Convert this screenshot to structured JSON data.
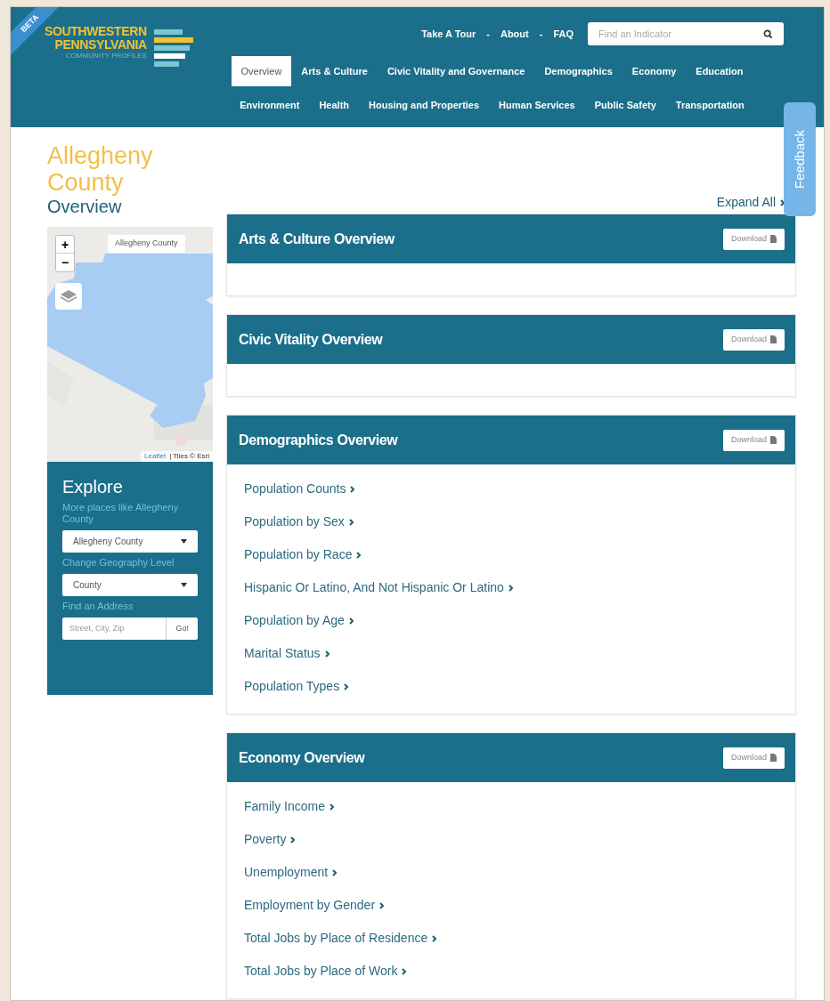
{
  "ribbon": "BETA",
  "logo": {
    "line_1": "SOUTHWESTERN",
    "line_2": "PENNSYLVANIA",
    "tagline": "COMMUNITY PROFILES"
  },
  "top_links": [
    {
      "label": "Take A Tour"
    },
    {
      "label": "About"
    },
    {
      "label": "FAQ"
    }
  ],
  "separator": "-",
  "search": {
    "placeholder": "Find an Indicator"
  },
  "nav_rows": [
    [
      {
        "label": "Overview",
        "selected": true
      },
      {
        "label": "Arts & Culture",
        "selected": false
      },
      {
        "label": "Civic Vitality and Governance",
        "selected": false
      },
      {
        "label": "Demographics",
        "selected": false
      },
      {
        "label": "Economy",
        "selected": false
      },
      {
        "label": "Education",
        "selected": false
      }
    ],
    [
      {
        "label": "Environment",
        "selected": false
      },
      {
        "label": "Health",
        "selected": false
      },
      {
        "label": "Housing and Properties",
        "selected": false
      },
      {
        "label": "Human Services",
        "selected": false
      },
      {
        "label": "Public Safety",
        "selected": false
      },
      {
        "label": "Transportation",
        "selected": false
      }
    ]
  ],
  "feedback": "Feedback",
  "place": {
    "name": "Allegheny County",
    "subtitle": "Overview"
  },
  "map": {
    "zoom_in": "+",
    "zoom_out": "−",
    "label": "Allegheny County",
    "attribution_link": "Leaflet",
    "attribution": "| Tiles © Esri"
  },
  "explore": {
    "title": "Explore",
    "fields": [
      {
        "kind": "select",
        "label": "More places like Allegheny County",
        "value": "Allegheny County"
      },
      {
        "kind": "select",
        "label": "Change Geography Level",
        "value": "County"
      },
      {
        "kind": "address",
        "label": "Find an Address",
        "placeholder": "Street, City, Zip",
        "button": "Go!"
      }
    ]
  },
  "expand_all": "Expand All",
  "sections": [
    {
      "title": "Arts & Culture Overview",
      "download": "Download"
    },
    {
      "title": "Civic Vitality Overview",
      "download": "Download"
    },
    {
      "title": "Demographics Overview",
      "download": "Download",
      "items": [
        "Population Counts",
        "Population by Sex",
        "Population by Race",
        "Hispanic Or Latino, And Not Hispanic Or Latino",
        "Population by Age",
        "Marital Status",
        "Population Types"
      ]
    },
    {
      "title": "Economy Overview",
      "download": "Download",
      "items": [
        "Family Income",
        "Poverty",
        "Unemployment",
        "Employment by Gender",
        "Total Jobs by Place of Residence",
        "Total Jobs by Place of Work"
      ]
    }
  ]
}
